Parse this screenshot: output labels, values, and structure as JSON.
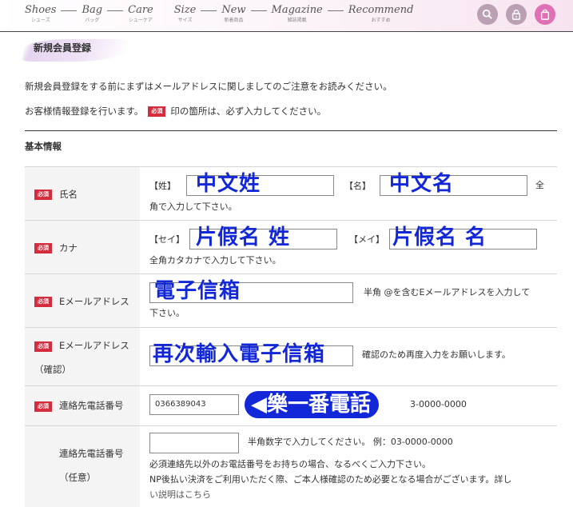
{
  "nav": {
    "items": [
      {
        "en": "Shoes",
        "jp": "シューズ"
      },
      {
        "en": "Bag",
        "jp": "バッグ"
      },
      {
        "en": "Care",
        "jp": "シューケア"
      },
      {
        "en": "Size",
        "jp": "サイズ"
      },
      {
        "en": "New",
        "jp": "新着商品"
      },
      {
        "en": "Magazine",
        "jp": "雑誌掲載"
      },
      {
        "en": "Recommend",
        "jp": "おすすめ"
      }
    ],
    "icons": [
      "search-icon",
      "lock-icon",
      "shopping-bag-icon"
    ]
  },
  "page": {
    "title": "新規会員登録",
    "intro1": "新規会員登録をする前にまずはメールアドレスに関しましてのご注意をお読みください。",
    "intro2_pre": "お客様情報登録を行います。",
    "intro2_post": "印の箇所は、必ず入力してください。",
    "required_badge": "必須",
    "section": "基本情報"
  },
  "form": {
    "name": {
      "label": "氏名",
      "last_bracket": "【姓】",
      "first_bracket": "【名】",
      "last_overlay": "中文姓",
      "first_overlay": "中文名",
      "note_a": "全",
      "note_b": "角で入力して下さい。"
    },
    "kana": {
      "label": "カナ",
      "last_bracket": "【セイ】",
      "first_bracket": "【メイ】",
      "last_overlay": "片假名 姓",
      "first_overlay": "片假名 名",
      "note": "全角カタカナで入力して下さい。"
    },
    "email": {
      "label": "Eメールアドレス",
      "overlay": "電子信箱",
      "note_a": "半角 @を含むEメールアドレスを入力して",
      "note_b": "下さい。"
    },
    "email_confirm": {
      "label": "Eメールアドレス",
      "label2": "（確認）",
      "overlay": "再次輸入電子信箱",
      "note": "確認のため再度入力をお願いします。"
    },
    "phone": {
      "label": "連絡先電話番号",
      "value": "0366389043",
      "overlay": "◀樂一番電話",
      "note_tail": "3-0000-0000"
    },
    "phone_optional": {
      "label": "連絡先電話番号",
      "label2": "（任意）",
      "value": "",
      "note1": "半角数字で入力してください。 例：03-0000-0000",
      "note2": "必須連絡先以外のお電話番号をお持ちの場合、なるべくご入力下さい。",
      "note3": "NP後払い決済をご利用いただく際、ご本人様確認のため必要となる場合がございます。詳し",
      "note4": "い説明はこちら"
    }
  },
  "colors": {
    "accent": "#d52d3e",
    "overlay": "#1228d8",
    "cart": "#e070b4"
  }
}
